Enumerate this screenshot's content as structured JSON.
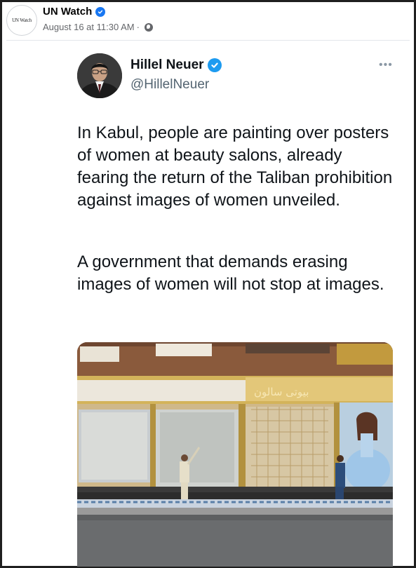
{
  "post": {
    "page_avatar_text": "UN Watch",
    "page_name": "UN Watch",
    "timestamp": "August 16 at 11:30 AM",
    "separator": "·",
    "audience_icon": "globe-icon",
    "verified_icon": "verified-badge-icon"
  },
  "tweet": {
    "author_name": "Hillel Neuer",
    "author_handle": "@HillelNeuer",
    "more_icon": "more-options-icon",
    "paragraphs": [
      "In Kabul, people are painting over posters of women at beauty salons, already fearing the return of the Taliban prohibition against images of women unveiled.",
      "A government that demands erasing images of women will not stop at images."
    ],
    "photo_sign_text": "بیوتی سالون"
  },
  "colors": {
    "fb_blue": "#1877f2",
    "twitter_blue": "#1d9bf0",
    "secondary_text": "#65676b",
    "handle_text": "#536471"
  }
}
